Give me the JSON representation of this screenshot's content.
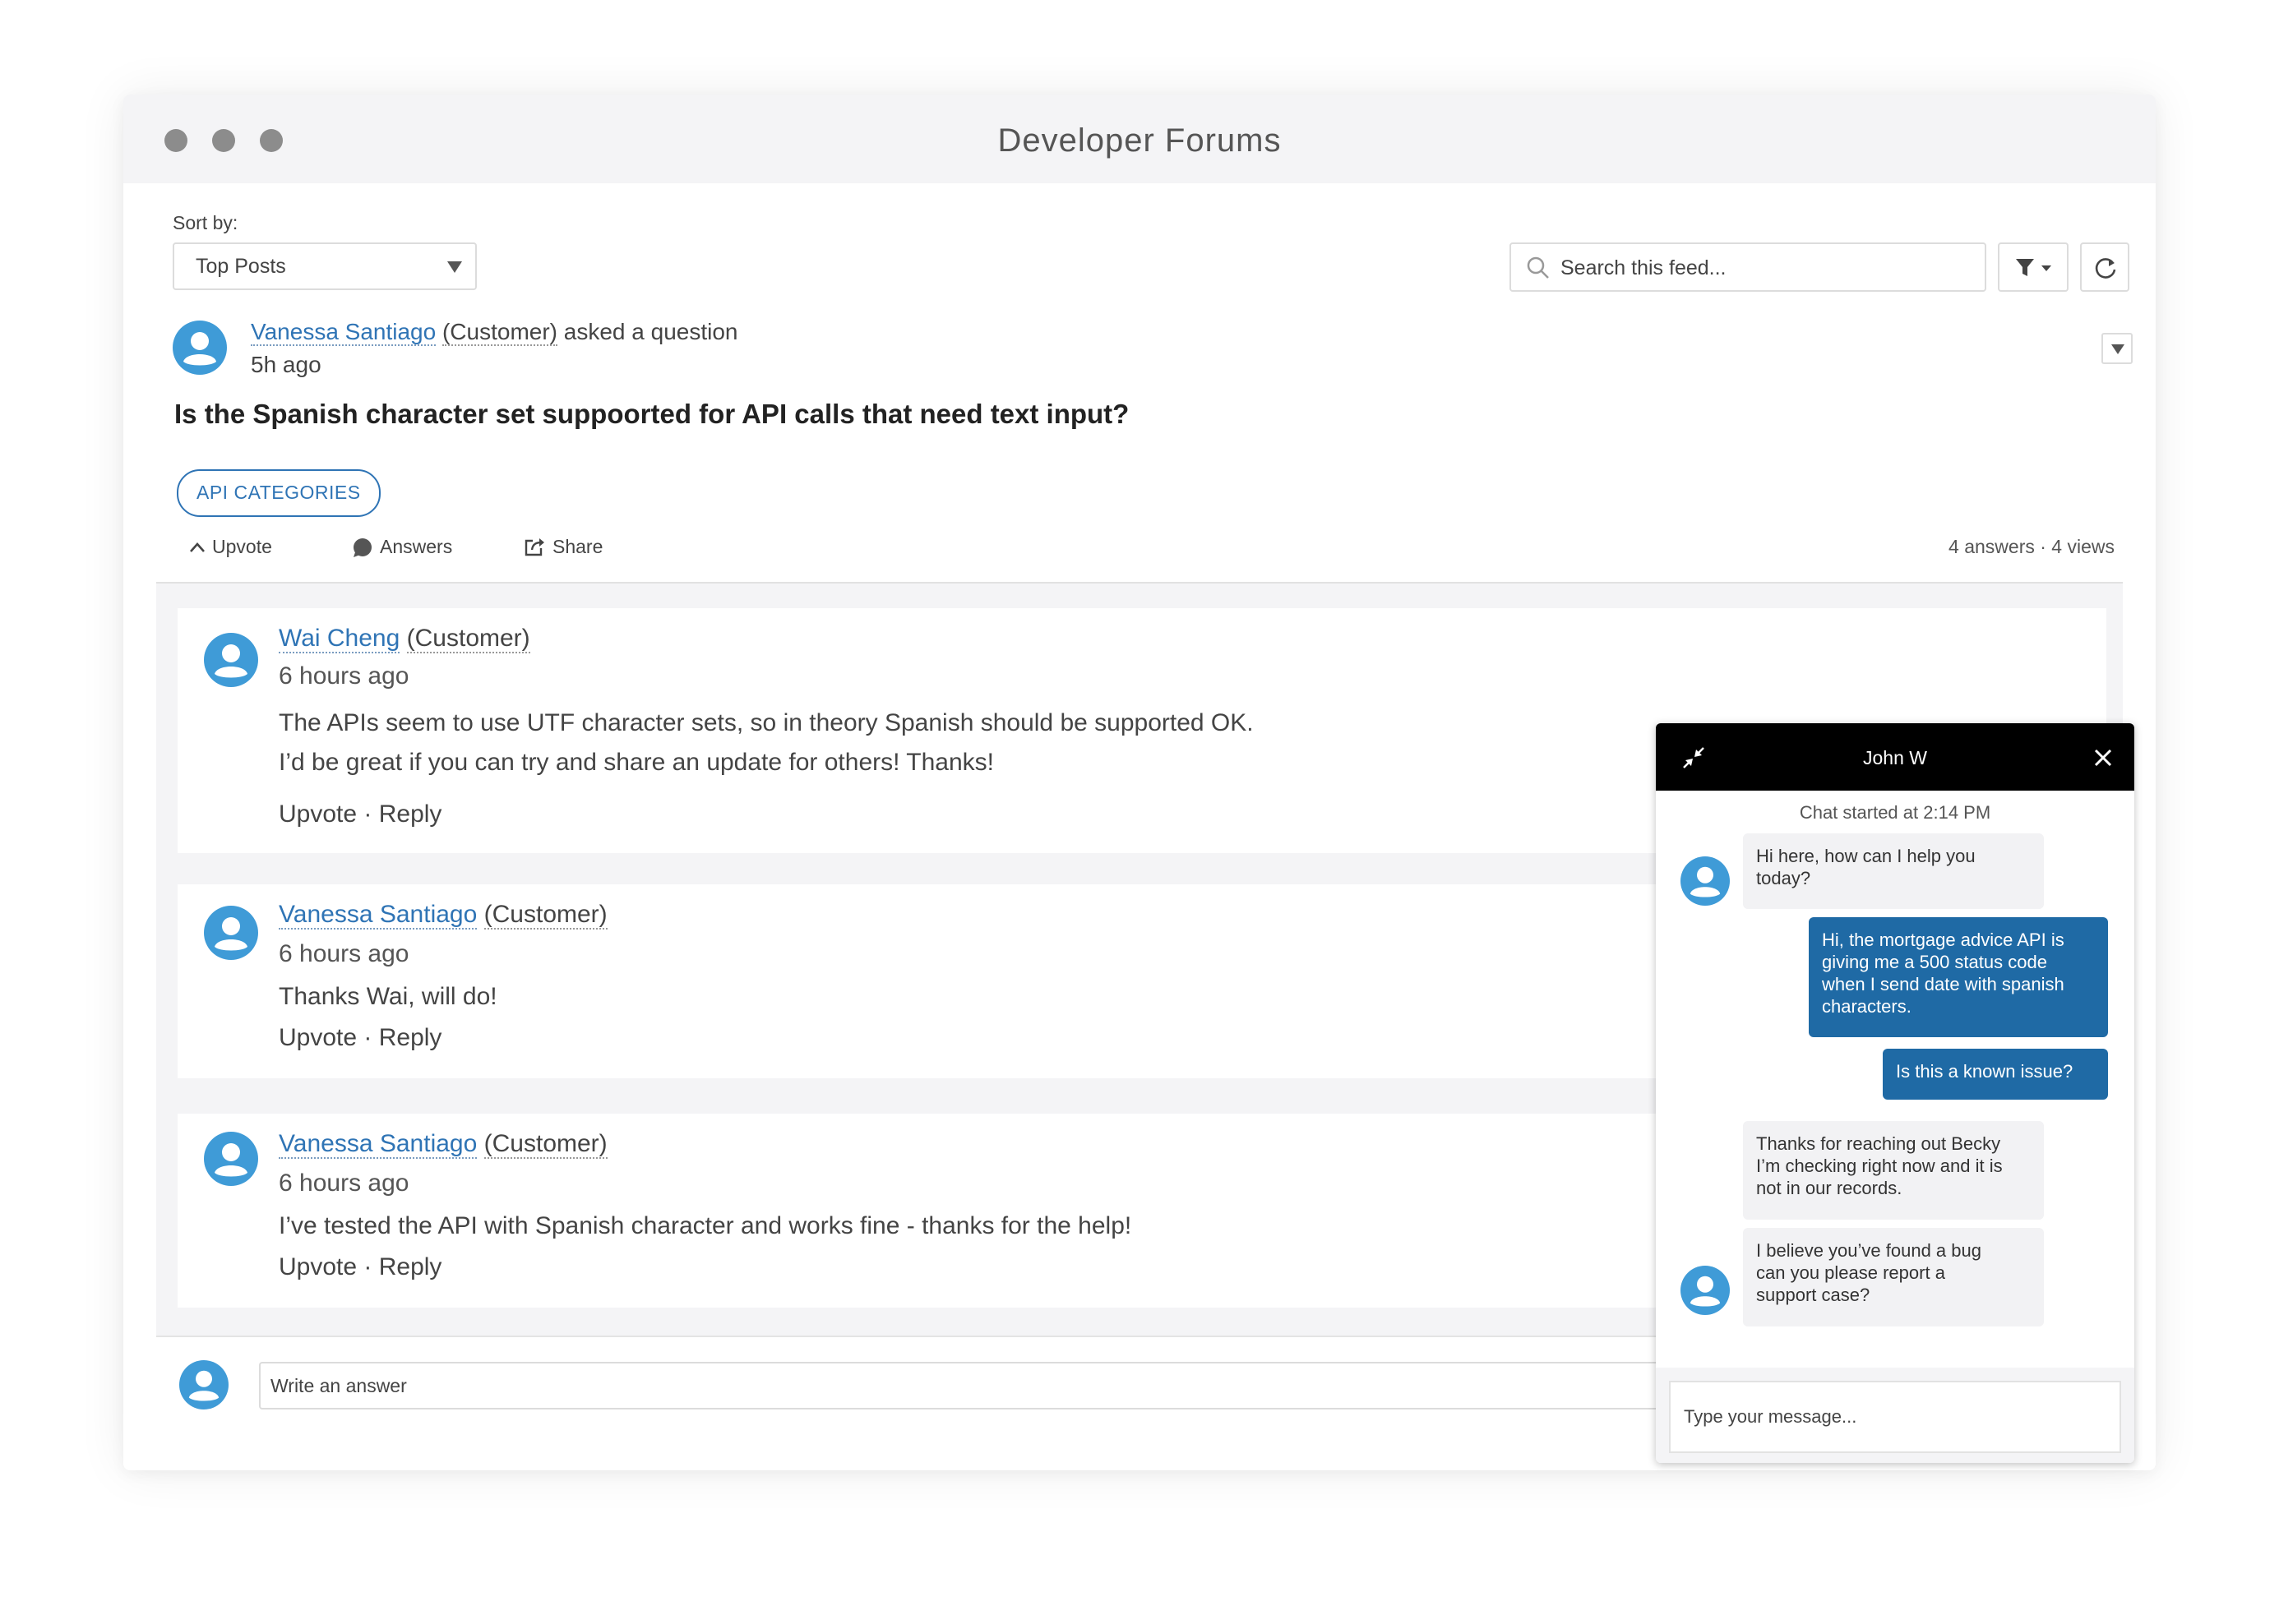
{
  "window": {
    "title": "Developer Forums"
  },
  "toolbar": {
    "sort_label": "Sort by:",
    "sort_value": "Top Posts",
    "search_placeholder": "Search this feed..."
  },
  "post": {
    "author": "Vanessa Santiago",
    "author_role": "(Customer)",
    "action": " asked a question",
    "time": "5h ago",
    "title": "Is the Spanish character set suppoorted for API calls that need text input?",
    "tag": "API CATEGORIES",
    "actions": {
      "upvote": "Upvote",
      "answers": "Answers",
      "share": "Share"
    },
    "stats": {
      "answers": "4 answers",
      "views": "· 4 views"
    }
  },
  "comments": [
    {
      "author": "Wai Cheng",
      "role": "(Customer)",
      "time": "6 hours ago",
      "lines": [
        "The APIs seem to use UTF character sets, so in theory Spanish should be supported OK.",
        "I’d be great if you can try and share an update for others! Thanks!"
      ],
      "upvote": "Upvote",
      "reply": "· Reply"
    },
    {
      "author": "Vanessa Santiago",
      "role": "(Customer)",
      "time": "6 hours ago",
      "lines": [
        "Thanks Wai, will do!"
      ],
      "upvote": "Upvote",
      "reply": "· Reply"
    },
    {
      "author": "Vanessa Santiago",
      "role": "(Customer)",
      "time": "6 hours ago",
      "lines": [
        "I’ve tested the API with Spanish character and works fine - thanks for the help!"
      ],
      "upvote": "Upvote",
      "reply": "· Reply"
    }
  ],
  "answer_placeholder": "Write an answer",
  "chat": {
    "name": "John W",
    "started": "Chat started at 2:14 PM",
    "messages": [
      {
        "from": "agent",
        "lines": [
          "Hi here, how can I help you",
          "today?"
        ]
      },
      {
        "from": "user",
        "lines": [
          "Hi, the mortgage advice API is",
          "giving me a 500 status code",
          "when I send date with spanish",
          "characters."
        ]
      },
      {
        "from": "user",
        "lines": [
          "Is this a known issue?"
        ]
      },
      {
        "from": "agent",
        "lines": [
          "Thanks for reaching out Becky",
          "I’m checking right now and it is",
          "not in our records."
        ]
      },
      {
        "from": "agent",
        "lines": [
          "I believe you’ve found a bug",
          "can you please report a",
          "support case?"
        ]
      }
    ],
    "input_placeholder": "Type your message..."
  },
  "colors": {
    "accent": "#2f74b5",
    "avatar": "#3f9bd7",
    "chat_header": "#000000",
    "user_bubble": "#1f6aa5"
  },
  "icons": [
    "search-icon",
    "filter-icon",
    "refresh-icon",
    "chevron-down-icon",
    "upvote-icon",
    "answers-icon",
    "share-icon",
    "minimize-icon",
    "close-icon",
    "avatar"
  ]
}
